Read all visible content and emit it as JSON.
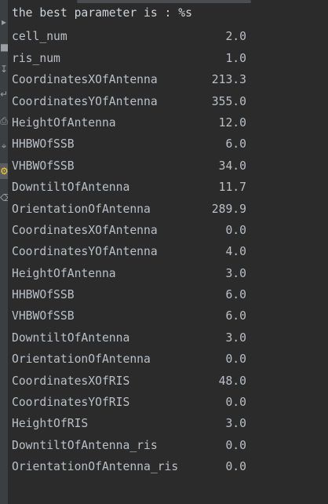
{
  "console": {
    "header": "the best parameter is : %s",
    "rows": [
      {
        "key": "cell_num",
        "value": "2.0"
      },
      {
        "key": "ris_num",
        "value": "1.0"
      },
      {
        "key": "CoordinatesXOfAntenna",
        "value": "213.3"
      },
      {
        "key": "CoordinatesYOfAntenna",
        "value": "355.0"
      },
      {
        "key": "HeightOfAntenna",
        "value": "12.0"
      },
      {
        "key": "HHBWOfSSB",
        "value": "6.0"
      },
      {
        "key": "VHBWOfSSB",
        "value": "34.0"
      },
      {
        "key": "DowntiltOfAntenna",
        "value": "11.7"
      },
      {
        "key": "OrientationOfAntenna",
        "value": "289.9"
      },
      {
        "key": "CoordinatesXOfAntenna",
        "value": "0.0"
      },
      {
        "key": "CoordinatesYOfAntenna",
        "value": "4.0"
      },
      {
        "key": "HeightOfAntenna",
        "value": "3.0"
      },
      {
        "key": "HHBWOfSSB",
        "value": "6.0"
      },
      {
        "key": "VHBWOfSSB",
        "value": "6.0"
      },
      {
        "key": "DowntiltOfAntenna",
        "value": "3.0"
      },
      {
        "key": "OrientationOfAntenna",
        "value": "0.0"
      },
      {
        "key": "CoordinatesXOfRIS",
        "value": "48.0"
      },
      {
        "key": "CoordinatesYOfRIS",
        "value": "0.0"
      },
      {
        "key": "HeightOfRIS",
        "value": "3.0"
      },
      {
        "key": "DowntiltOfAntenna_ris",
        "value": "0.0"
      },
      {
        "key": "OrientationOfAntenna_ris",
        "value": "0.0"
      }
    ]
  },
  "gutter": {
    "icons": [
      "rerun-icon",
      "stop-icon",
      "scroll-to-end-icon",
      "soft-wrap-icon",
      "print-icon",
      "pin-icon",
      "settings-icon",
      "delete-icon"
    ]
  },
  "colors": {
    "background": "#2b2b2b",
    "text": "#b9c0c7",
    "gutter": "#3c3f41"
  }
}
